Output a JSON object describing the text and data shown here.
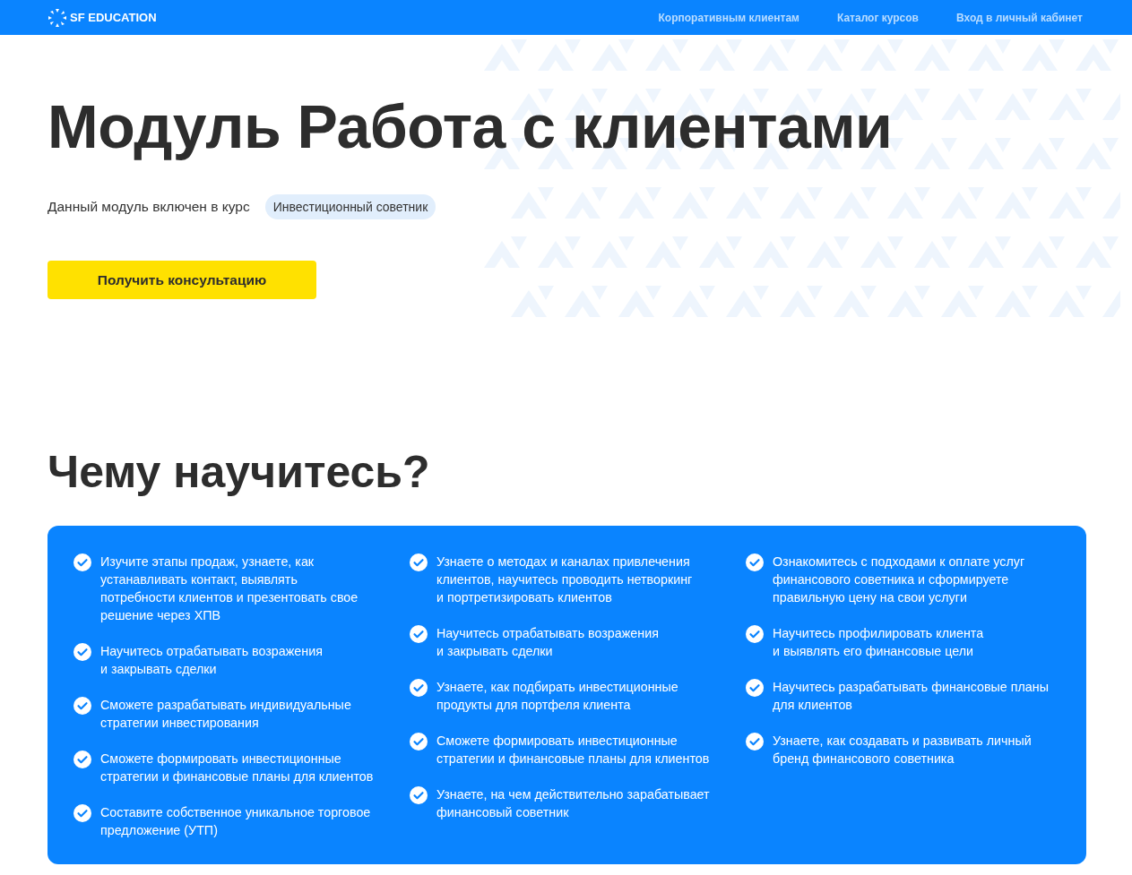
{
  "header": {
    "logo": "SF EDUCATION",
    "nav": [
      "Корпоративным клиентам",
      "Каталог курсов",
      "Вход в личный кабинет"
    ]
  },
  "hero": {
    "title": "Модуль Работа с клиентами",
    "course_note": "Данный модуль включен в курс",
    "course_tag": "Инвестиционный советник",
    "cta": "Получить консультацию"
  },
  "learn": {
    "title": "Чему научитесь?",
    "columns": [
      [
        "Изучите этапы продаж, узнаете, как\nустанавливать контакт, выявлять\nпотребности клиентов и презентовать свое\nрешение через ХПВ",
        "Научитесь отрабатывать возражения\nи закрывать сделки",
        "Сможете разрабатывать индивидуальные\nстратегии инвестирования",
        "Сможете формировать инвестиционные\nстратегии и финансовые планы для клиентов",
        "Составите собственное уникальное торговое\nпредложение (УТП)"
      ],
      [
        "Узнаете о методах и каналах привлечения\nклиентов, научитесь проводить нетворкинг\nи портретизировать клиентов",
        "Научитесь отрабатывать возражения\nи закрывать сделки",
        "Узнаете, как подбирать инвестиционные\nпродукты для портфеля клиента",
        "Сможете формировать инвестиционные\nстратегии и финансовые планы для клиентов",
        "Узнаете, на чем действительно зарабатывает\nфинансовый советник"
      ],
      [
        "Ознакомитесь с подходами к оплате услуг\nфинансового советника и сформируете\nправильную цену на свои услуги",
        "Научитесь профилировать клиента\nи выявлять его финансовые цели",
        "Научитесь разрабатывать финансовые планы\nдля клиентов",
        "Узнаете, как создавать и развивать личный\nбренд финансового советника"
      ]
    ]
  }
}
